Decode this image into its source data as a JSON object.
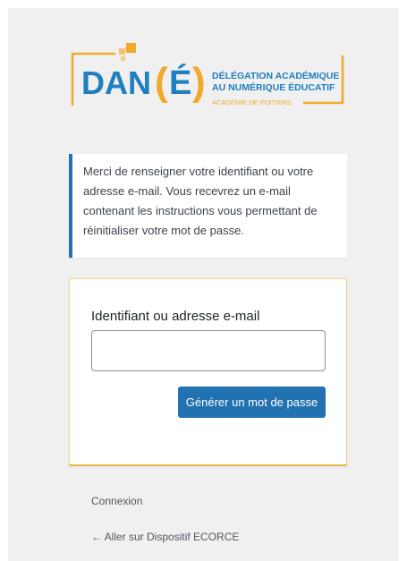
{
  "logo": {
    "main_text_1": "DAN",
    "main_text_2": "É",
    "line1": "DÉLÉGATION ACADÉMIQUE",
    "line2": "AU NUMÉRIQUE ÉDUCATIF",
    "line3": "ACADÉMIE DE POITIERS",
    "colors": {
      "blue": "#1f7fbf",
      "orange": "#f0a92b",
      "light_orange": "#f6d08a"
    }
  },
  "notice": {
    "text": "Merci de renseigner votre identifiant ou votre adresse e-mail. Vous recevrez un e-mail contenant les instructions vous permettant de réinitialiser votre mot de passe."
  },
  "form": {
    "label": "Identifiant ou adresse e-mail",
    "input_value": "",
    "submit_label": "Générer un mot de passe"
  },
  "links": {
    "login": "Connexion",
    "back": "← Aller sur Dispositif ECORCE"
  },
  "colors": {
    "accent": "#2271b1",
    "background": "#f0f0f1",
    "card_border": "#e6b84a"
  }
}
